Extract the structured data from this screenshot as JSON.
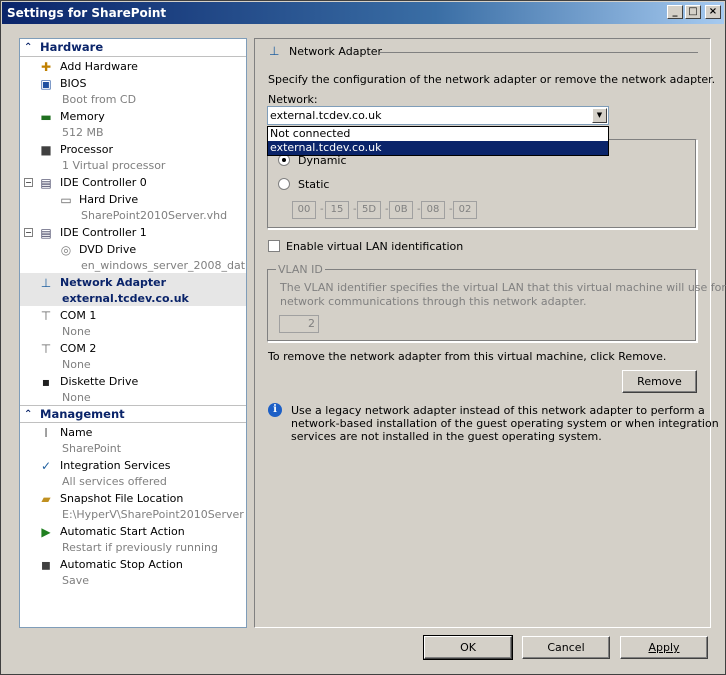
{
  "window": {
    "title": "Settings for SharePoint"
  },
  "tree": {
    "hardware_label": "Hardware",
    "management_label": "Management",
    "hardware": [
      {
        "label": "Add Hardware",
        "sub": "",
        "icon": "add-hardware-icon"
      },
      {
        "label": "BIOS",
        "sub": "Boot from CD",
        "icon": "bios-icon"
      },
      {
        "label": "Memory",
        "sub": "512 MB",
        "icon": "memory-icon"
      },
      {
        "label": "Processor",
        "sub": "1 Virtual processor",
        "icon": "processor-icon"
      },
      {
        "label": "IDE Controller 0",
        "sub": "",
        "icon": "ide-controller-icon"
      },
      {
        "label": "Hard Drive",
        "sub": "SharePoint2010Server.vhd",
        "icon": "hard-drive-icon"
      },
      {
        "label": "IDE Controller 1",
        "sub": "",
        "icon": "ide-controller-icon"
      },
      {
        "label": "DVD Drive",
        "sub": "en_windows_server_2008_dat...",
        "icon": "dvd-drive-icon"
      },
      {
        "label": "Network Adapter",
        "sub": "external.tcdev.co.uk",
        "icon": "network-adapter-icon"
      },
      {
        "label": "COM 1",
        "sub": "None",
        "icon": "com-port-icon"
      },
      {
        "label": "COM 2",
        "sub": "None",
        "icon": "com-port-icon"
      },
      {
        "label": "Diskette Drive",
        "sub": "None",
        "icon": "diskette-icon"
      }
    ],
    "management": [
      {
        "label": "Name",
        "sub": "SharePoint",
        "icon": "name-icon"
      },
      {
        "label": "Integration Services",
        "sub": "All services offered",
        "icon": "integration-services-icon"
      },
      {
        "label": "Snapshot File Location",
        "sub": "E:\\HyperV\\SharePoint2010Server",
        "icon": "snapshot-folder-icon"
      },
      {
        "label": "Automatic Start Action",
        "sub": "Restart if previously running",
        "icon": "start-action-icon"
      },
      {
        "label": "Automatic Stop Action",
        "sub": "Save",
        "icon": "stop-action-icon"
      }
    ]
  },
  "panel": {
    "title": "Network Adapter",
    "description": "Specify the configuration of the network adapter or remove the network adapter.",
    "network_label": "Network:",
    "network_value": "external.tcdev.co.uk",
    "dropdown_options": [
      "Not connected",
      "external.tcdev.co.uk"
    ],
    "mac": {
      "dynamic_label": "Dynamic",
      "static_label": "Static",
      "octets": [
        "00",
        "15",
        "5D",
        "0B",
        "08",
        "02"
      ]
    },
    "vlan_checkbox_label": "Enable virtual LAN identification",
    "vlan_group_label": "VLAN ID",
    "vlan_desc_line1": "The VLAN identifier specifies the virtual LAN that this virtual machine will use for all",
    "vlan_desc_line2": "network communications through this network adapter.",
    "vlan_value": "2",
    "remove_text": "To remove the network adapter from this virtual machine, click Remove.",
    "remove_button": "Remove",
    "info_line1": "Use a legacy network adapter instead of this network adapter to perform a",
    "info_line2": "network-based installation of the guest operating system or when integration",
    "info_line3": "services are not installed in the guest operating system."
  },
  "buttons": {
    "ok": "OK",
    "cancel": "Cancel",
    "apply": "Apply"
  }
}
